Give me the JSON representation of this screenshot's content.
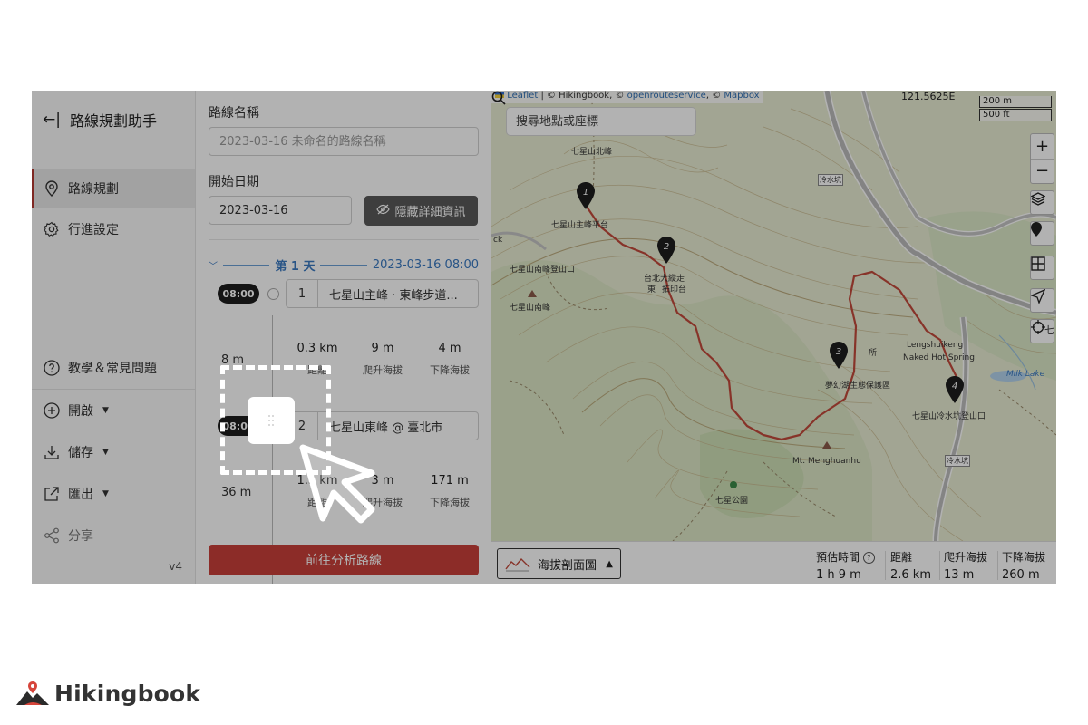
{
  "sidebar": {
    "title": "路線規劃助手",
    "nav": [
      {
        "label": "路線規劃",
        "active": true
      },
      {
        "label": "行進設定",
        "active": false
      }
    ],
    "help": "教學＆常見問題",
    "actions": [
      {
        "label": "開啟"
      },
      {
        "label": "儲存"
      },
      {
        "label": "匯出"
      }
    ],
    "share": "分享",
    "version": "v4"
  },
  "form": {
    "route_name_label": "路線名稱",
    "route_name_placeholder": "2023-03-16 未命名的路線名稱",
    "start_date_label": "開始日期",
    "start_date_value": "2023-03-16",
    "hide_details_label": "隱藏詳細資訊"
  },
  "itinerary": {
    "day_label": "第 1 天",
    "day_datetime": "2023-03-16 08:00",
    "points": [
      {
        "time": "08:00",
        "index": "1",
        "name": "七星山主峰 · 東峰步道..."
      },
      {
        "time": "08:08",
        "index": "2",
        "name": "七星山東峰 @ 臺北市"
      }
    ],
    "segments": [
      {
        "elevation": "8 m",
        "distance": "0.3 km",
        "ascent": "9 m",
        "descent": "4 m"
      },
      {
        "elevation": "36 m",
        "distance": "1.3 km",
        "ascent": "3 m",
        "descent": "171 m"
      }
    ],
    "stat_labels": {
      "distance": "距離",
      "ascent": "爬升海拔",
      "descent": "下降海拔"
    },
    "analyze_button": "前往分析路線"
  },
  "map": {
    "attribution": {
      "leaflet": "Leaflet",
      "hikingbook": "| © Hikingbook, ©",
      "ors": "openrouteservice",
      "sep": ", ©",
      "mapbox": "Mapbox"
    },
    "coordinate": "121.5625E",
    "scale": [
      "200 m",
      "500 ft"
    ],
    "search_placeholder": "搜尋地點或座標",
    "zoom_in": "+",
    "zoom_out": "−",
    "labels": {
      "north_peak": "七星山北峰",
      "main_peak": "七星山主峰平台",
      "south_trailhead": "七星山南峰登山口",
      "south_peak": "七星山南峰",
      "taipei_trail": "台北大縱走",
      "trail_east": "東",
      "trail_rubbing": "拓印台",
      "reserve": "夢幻湖生態保護區",
      "lengshuikeng_en1": "Lengshuikeng",
      "lengshuikeng_en2": "Naked Hot Spring",
      "lengshuikeng_trailhead": "七星山冷水坑登山口",
      "menghuanhu": "Mt. Menghuanhu",
      "park": "七星公園",
      "milk_lake": "Milk Lake",
      "road_sign_1": "冷水坑",
      "road_sign_2": "冷水坑",
      "station_fragment": "所",
      "map_edge_fragment": "ck",
      "edge_char": "七"
    },
    "markers": [
      "1",
      "2",
      "3",
      "4"
    ]
  },
  "summary": {
    "elevation_profile_label": "海拔剖面圖",
    "items": [
      {
        "label": "預估時間",
        "value": "1 h 9 m"
      },
      {
        "label": "距離",
        "value": "2.6 km"
      },
      {
        "label": "爬升海拔",
        "value": "13 m"
      },
      {
        "label": "下降海拔",
        "value": "260 m"
      }
    ]
  },
  "brand": {
    "name": "Hikingbook"
  },
  "colors": {
    "accent": "#c9403a",
    "link": "#3a79c1",
    "route": "#c24a3b"
  }
}
